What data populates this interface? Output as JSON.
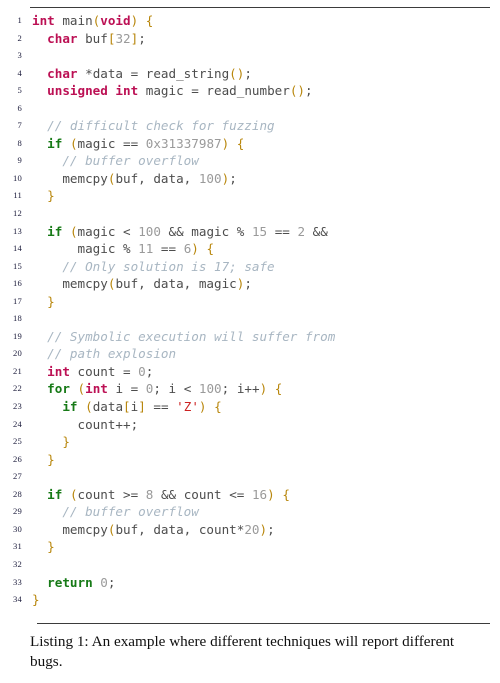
{
  "figure": {
    "type": "code-listing",
    "language": "C",
    "caption": "Listing 1: An example where different techniques will report different bugs.",
    "caption_label": "Listing 1:",
    "rules": {
      "top": true,
      "bottom": true
    },
    "line_count": 34
  },
  "colors": {
    "type_keyword": "#bc1054",
    "control_keyword": "#177a17",
    "comment": "#a8b6c2",
    "string_literal": "#cc2222",
    "number_literal": "#9a9a9a",
    "identifier": "#4d4d4d",
    "bracket": "#b8860b",
    "line_number": "#1c1c3c",
    "rule": "#3b3b3b",
    "background": "#ffffff"
  },
  "code": {
    "lines": [
      {
        "n": "1",
        "tokens": [
          {
            "t": "type",
            "v": "int"
          },
          {
            "t": "id",
            "v": " main"
          },
          {
            "t": "brk",
            "v": "("
          },
          {
            "t": "type",
            "v": "void"
          },
          {
            "t": "brk",
            "v": ")"
          },
          {
            "t": "punc",
            "v": " "
          },
          {
            "t": "brk",
            "v": "{"
          }
        ]
      },
      {
        "n": "2",
        "tokens": [
          {
            "t": "punc",
            "v": "  "
          },
          {
            "t": "type",
            "v": "char"
          },
          {
            "t": "id",
            "v": " buf"
          },
          {
            "t": "brk",
            "v": "["
          },
          {
            "t": "num",
            "v": "32"
          },
          {
            "t": "brk",
            "v": "]"
          },
          {
            "t": "punc",
            "v": ";"
          }
        ]
      },
      {
        "n": "3",
        "tokens": []
      },
      {
        "n": "4",
        "tokens": [
          {
            "t": "punc",
            "v": "  "
          },
          {
            "t": "type",
            "v": "char"
          },
          {
            "t": "punc",
            "v": " *"
          },
          {
            "t": "id",
            "v": "data = read_string"
          },
          {
            "t": "brk",
            "v": "()"
          },
          {
            "t": "punc",
            "v": ";"
          }
        ]
      },
      {
        "n": "5",
        "tokens": [
          {
            "t": "punc",
            "v": "  "
          },
          {
            "t": "type",
            "v": "unsigned int"
          },
          {
            "t": "id",
            "v": " magic = read_number"
          },
          {
            "t": "brk",
            "v": "()"
          },
          {
            "t": "punc",
            "v": ";"
          }
        ]
      },
      {
        "n": "6",
        "tokens": []
      },
      {
        "n": "7",
        "tokens": [
          {
            "t": "punc",
            "v": "  "
          },
          {
            "t": "com",
            "v": "// difficult check for fuzzing"
          }
        ]
      },
      {
        "n": "8",
        "tokens": [
          {
            "t": "punc",
            "v": "  "
          },
          {
            "t": "kw",
            "v": "if"
          },
          {
            "t": "punc",
            "v": " "
          },
          {
            "t": "brk",
            "v": "("
          },
          {
            "t": "id",
            "v": "magic == "
          },
          {
            "t": "num",
            "v": "0x31337987"
          },
          {
            "t": "brk",
            "v": ")"
          },
          {
            "t": "punc",
            "v": " "
          },
          {
            "t": "brk",
            "v": "{"
          }
        ]
      },
      {
        "n": "9",
        "tokens": [
          {
            "t": "punc",
            "v": "    "
          },
          {
            "t": "com",
            "v": "// buffer overflow"
          }
        ]
      },
      {
        "n": "10",
        "tokens": [
          {
            "t": "punc",
            "v": "    "
          },
          {
            "t": "id",
            "v": "memcpy"
          },
          {
            "t": "brk",
            "v": "("
          },
          {
            "t": "id",
            "v": "buf, data, "
          },
          {
            "t": "num",
            "v": "100"
          },
          {
            "t": "brk",
            "v": ")"
          },
          {
            "t": "punc",
            "v": ";"
          }
        ]
      },
      {
        "n": "11",
        "tokens": [
          {
            "t": "punc",
            "v": "  "
          },
          {
            "t": "brk",
            "v": "}"
          }
        ]
      },
      {
        "n": "12",
        "tokens": []
      },
      {
        "n": "13",
        "tokens": [
          {
            "t": "punc",
            "v": "  "
          },
          {
            "t": "kw",
            "v": "if"
          },
          {
            "t": "punc",
            "v": " "
          },
          {
            "t": "brk",
            "v": "("
          },
          {
            "t": "id",
            "v": "magic < "
          },
          {
            "t": "num",
            "v": "100"
          },
          {
            "t": "punc",
            "v": " && "
          },
          {
            "t": "id",
            "v": "magic % "
          },
          {
            "t": "num",
            "v": "15"
          },
          {
            "t": "punc",
            "v": " == "
          },
          {
            "t": "num",
            "v": "2"
          },
          {
            "t": "punc",
            "v": " &&"
          }
        ]
      },
      {
        "n": "14",
        "tokens": [
          {
            "t": "punc",
            "v": "      "
          },
          {
            "t": "id",
            "v": "magic % "
          },
          {
            "t": "num",
            "v": "11"
          },
          {
            "t": "punc",
            "v": " == "
          },
          {
            "t": "num",
            "v": "6"
          },
          {
            "t": "brk",
            "v": ")"
          },
          {
            "t": "punc",
            "v": " "
          },
          {
            "t": "brk",
            "v": "{"
          }
        ]
      },
      {
        "n": "15",
        "tokens": [
          {
            "t": "punc",
            "v": "    "
          },
          {
            "t": "com",
            "v": "// Only solution is 17; safe"
          }
        ]
      },
      {
        "n": "16",
        "tokens": [
          {
            "t": "punc",
            "v": "    "
          },
          {
            "t": "id",
            "v": "memcpy"
          },
          {
            "t": "brk",
            "v": "("
          },
          {
            "t": "id",
            "v": "buf, data, magic"
          },
          {
            "t": "brk",
            "v": ")"
          },
          {
            "t": "punc",
            "v": ";"
          }
        ]
      },
      {
        "n": "17",
        "tokens": [
          {
            "t": "punc",
            "v": "  "
          },
          {
            "t": "brk",
            "v": "}"
          }
        ]
      },
      {
        "n": "18",
        "tokens": []
      },
      {
        "n": "19",
        "tokens": [
          {
            "t": "punc",
            "v": "  "
          },
          {
            "t": "com",
            "v": "// Symbolic execution will suffer from"
          }
        ]
      },
      {
        "n": "20",
        "tokens": [
          {
            "t": "punc",
            "v": "  "
          },
          {
            "t": "com",
            "v": "// path explosion"
          }
        ]
      },
      {
        "n": "21",
        "tokens": [
          {
            "t": "punc",
            "v": "  "
          },
          {
            "t": "type",
            "v": "int"
          },
          {
            "t": "id",
            "v": " count = "
          },
          {
            "t": "num",
            "v": "0"
          },
          {
            "t": "punc",
            "v": ";"
          }
        ]
      },
      {
        "n": "22",
        "tokens": [
          {
            "t": "punc",
            "v": "  "
          },
          {
            "t": "kw",
            "v": "for"
          },
          {
            "t": "punc",
            "v": " "
          },
          {
            "t": "brk",
            "v": "("
          },
          {
            "t": "type",
            "v": "int"
          },
          {
            "t": "id",
            "v": " i = "
          },
          {
            "t": "num",
            "v": "0"
          },
          {
            "t": "punc",
            "v": "; "
          },
          {
            "t": "id",
            "v": "i < "
          },
          {
            "t": "num",
            "v": "100"
          },
          {
            "t": "punc",
            "v": "; "
          },
          {
            "t": "id",
            "v": "i++"
          },
          {
            "t": "brk",
            "v": ")"
          },
          {
            "t": "punc",
            "v": " "
          },
          {
            "t": "brk",
            "v": "{"
          }
        ]
      },
      {
        "n": "23",
        "tokens": [
          {
            "t": "punc",
            "v": "    "
          },
          {
            "t": "kw",
            "v": "if"
          },
          {
            "t": "punc",
            "v": " "
          },
          {
            "t": "brk",
            "v": "("
          },
          {
            "t": "id",
            "v": "data"
          },
          {
            "t": "brk",
            "v": "["
          },
          {
            "t": "id",
            "v": "i"
          },
          {
            "t": "brk",
            "v": "]"
          },
          {
            "t": "punc",
            "v": " == "
          },
          {
            "t": "str",
            "v": "'Z'"
          },
          {
            "t": "brk",
            "v": ")"
          },
          {
            "t": "punc",
            "v": " "
          },
          {
            "t": "brk",
            "v": "{"
          }
        ]
      },
      {
        "n": "24",
        "tokens": [
          {
            "t": "punc",
            "v": "      "
          },
          {
            "t": "id",
            "v": "count++"
          },
          {
            "t": "punc",
            "v": ";"
          }
        ]
      },
      {
        "n": "25",
        "tokens": [
          {
            "t": "punc",
            "v": "    "
          },
          {
            "t": "brk",
            "v": "}"
          }
        ]
      },
      {
        "n": "26",
        "tokens": [
          {
            "t": "punc",
            "v": "  "
          },
          {
            "t": "brk",
            "v": "}"
          }
        ]
      },
      {
        "n": "27",
        "tokens": []
      },
      {
        "n": "28",
        "tokens": [
          {
            "t": "punc",
            "v": "  "
          },
          {
            "t": "kw",
            "v": "if"
          },
          {
            "t": "punc",
            "v": " "
          },
          {
            "t": "brk",
            "v": "("
          },
          {
            "t": "id",
            "v": "count >= "
          },
          {
            "t": "num",
            "v": "8"
          },
          {
            "t": "punc",
            "v": " && "
          },
          {
            "t": "id",
            "v": "count <= "
          },
          {
            "t": "num",
            "v": "16"
          },
          {
            "t": "brk",
            "v": ")"
          },
          {
            "t": "punc",
            "v": " "
          },
          {
            "t": "brk",
            "v": "{"
          }
        ]
      },
      {
        "n": "29",
        "tokens": [
          {
            "t": "punc",
            "v": "    "
          },
          {
            "t": "com",
            "v": "// buffer overflow"
          }
        ]
      },
      {
        "n": "30",
        "tokens": [
          {
            "t": "punc",
            "v": "    "
          },
          {
            "t": "id",
            "v": "memcpy"
          },
          {
            "t": "brk",
            "v": "("
          },
          {
            "t": "id",
            "v": "buf, data, count*"
          },
          {
            "t": "num",
            "v": "20"
          },
          {
            "t": "brk",
            "v": ")"
          },
          {
            "t": "punc",
            "v": ";"
          }
        ]
      },
      {
        "n": "31",
        "tokens": [
          {
            "t": "punc",
            "v": "  "
          },
          {
            "t": "brk",
            "v": "}"
          }
        ]
      },
      {
        "n": "32",
        "tokens": []
      },
      {
        "n": "33",
        "tokens": [
          {
            "t": "punc",
            "v": "  "
          },
          {
            "t": "kw",
            "v": "return"
          },
          {
            "t": "punc",
            "v": " "
          },
          {
            "t": "num",
            "v": "0"
          },
          {
            "t": "punc",
            "v": ";"
          }
        ]
      },
      {
        "n": "34",
        "tokens": [
          {
            "t": "brk",
            "v": "}"
          }
        ]
      }
    ]
  }
}
